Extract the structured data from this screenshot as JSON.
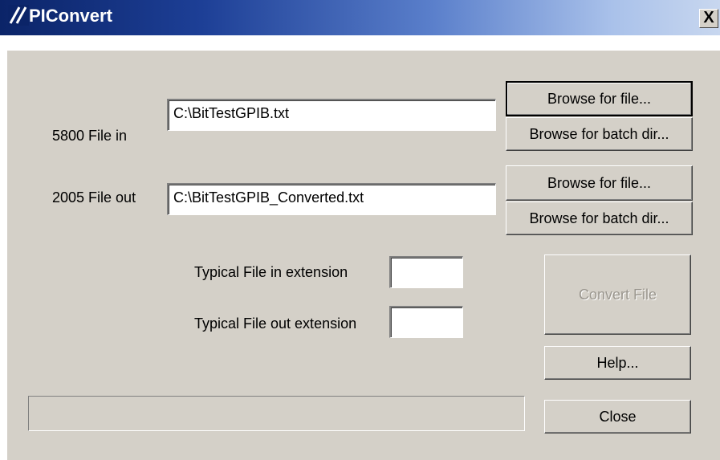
{
  "window": {
    "title": "PIConvert",
    "close_glyph": "X",
    "logo_icon": "piconvert-logo-icon"
  },
  "file_in": {
    "label": "5800 File in",
    "value": "C:\\BitTestGPIB.txt",
    "browse_file_label": "Browse for file...",
    "browse_dir_label": "Browse for batch dir..."
  },
  "file_out": {
    "label": "2005 File out",
    "value": "C:\\BitTestGPIB_Converted.txt",
    "browse_file_label": "Browse for file...",
    "browse_dir_label": "Browse for batch dir..."
  },
  "extensions": {
    "in_label": "Typical File in extension",
    "in_value": "",
    "out_label": "Typical File out extension",
    "out_value": ""
  },
  "actions": {
    "convert_label": "Convert File",
    "help_label": "Help...",
    "close_label": "Close"
  },
  "progress": {
    "percent": 0
  },
  "colors": {
    "titlebar_start": "#0b2468",
    "titlebar_end": "#c8d7ef",
    "face": "#d4d0c8",
    "disabled_text": "#9a968e"
  }
}
